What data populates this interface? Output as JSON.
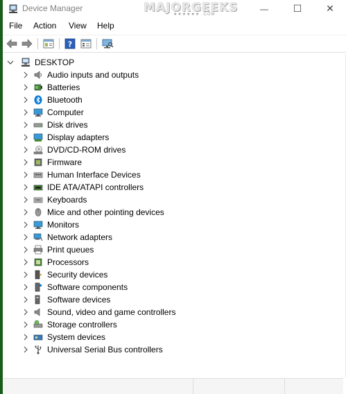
{
  "window": {
    "title": "Device Manager",
    "watermark": "MAJORGEEKS",
    "watermark_sub": "★★★★★★ .COM",
    "minimize": "—",
    "maximize": "☐",
    "close": "✕"
  },
  "menu": {
    "items": [
      "File",
      "Action",
      "View",
      "Help"
    ]
  },
  "toolbar": {
    "icons": [
      "back-arrow-icon",
      "forward-arrow-icon",
      "properties-icon",
      "help-icon",
      "show-hidden-icon",
      "scan-hardware-icon"
    ]
  },
  "tree": {
    "root": "DESKTOP",
    "items": [
      {
        "label": "Audio inputs and outputs",
        "icon": "speaker-icon"
      },
      {
        "label": "Batteries",
        "icon": "battery-icon"
      },
      {
        "label": "Bluetooth",
        "icon": "bluetooth-icon"
      },
      {
        "label": "Computer",
        "icon": "computer-icon"
      },
      {
        "label": "Disk drives",
        "icon": "disk-drive-icon"
      },
      {
        "label": "Display adapters",
        "icon": "display-adapter-icon"
      },
      {
        "label": "DVD/CD-ROM drives",
        "icon": "dvd-drive-icon"
      },
      {
        "label": "Firmware",
        "icon": "firmware-icon"
      },
      {
        "label": "Human Interface Devices",
        "icon": "hid-icon"
      },
      {
        "label": "IDE ATA/ATAPI controllers",
        "icon": "ide-controller-icon"
      },
      {
        "label": "Keyboards",
        "icon": "keyboard-icon"
      },
      {
        "label": "Mice and other pointing devices",
        "icon": "mouse-icon"
      },
      {
        "label": "Monitors",
        "icon": "monitor-icon"
      },
      {
        "label": "Network adapters",
        "icon": "network-adapter-icon"
      },
      {
        "label": "Print queues",
        "icon": "printer-icon"
      },
      {
        "label": "Processors",
        "icon": "processor-icon"
      },
      {
        "label": "Security devices",
        "icon": "security-device-icon"
      },
      {
        "label": "Software components",
        "icon": "software-component-icon"
      },
      {
        "label": "Software devices",
        "icon": "software-device-icon"
      },
      {
        "label": "Sound, video and game controllers",
        "icon": "sound-controller-icon"
      },
      {
        "label": "Storage controllers",
        "icon": "storage-controller-icon"
      },
      {
        "label": "System devices",
        "icon": "system-devices-icon"
      },
      {
        "label": "Universal Serial Bus controllers",
        "icon": "usb-icon"
      }
    ]
  },
  "colors": {
    "accent": "#1a5c1a",
    "bluetooth": "#0078d7",
    "monitor_blue": "#3a9ad9"
  }
}
